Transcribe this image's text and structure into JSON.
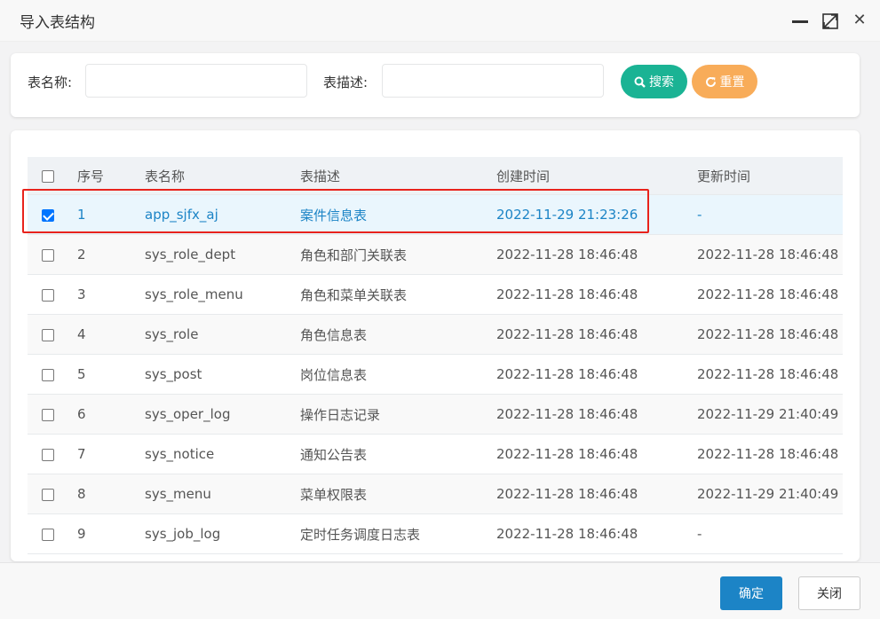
{
  "window": {
    "title": "导入表结构"
  },
  "search": {
    "table_name_label": "表名称:",
    "table_name_value": "",
    "table_desc_label": "表描述:",
    "table_desc_value": "",
    "search_label": "搜索",
    "reset_label": "重置"
  },
  "table": {
    "headers": [
      "序号",
      "表名称",
      "表描述",
      "创建时间",
      "更新时间"
    ],
    "rows": [
      {
        "checked": true,
        "no": "1",
        "name": "app_sjfx_aj",
        "desc": "案件信息表",
        "created": "2022-11-29 21:23:26",
        "updated": "-"
      },
      {
        "checked": false,
        "no": "2",
        "name": "sys_role_dept",
        "desc": "角色和部门关联表",
        "created": "2022-11-28 18:46:48",
        "updated": "2022-11-28 18:46:48"
      },
      {
        "checked": false,
        "no": "3",
        "name": "sys_role_menu",
        "desc": "角色和菜单关联表",
        "created": "2022-11-28 18:46:48",
        "updated": "2022-11-28 18:46:48"
      },
      {
        "checked": false,
        "no": "4",
        "name": "sys_role",
        "desc": "角色信息表",
        "created": "2022-11-28 18:46:48",
        "updated": "2022-11-28 18:46:48"
      },
      {
        "checked": false,
        "no": "5",
        "name": "sys_post",
        "desc": "岗位信息表",
        "created": "2022-11-28 18:46:48",
        "updated": "2022-11-28 18:46:48"
      },
      {
        "checked": false,
        "no": "6",
        "name": "sys_oper_log",
        "desc": "操作日志记录",
        "created": "2022-11-28 18:46:48",
        "updated": "2022-11-29 21:40:49"
      },
      {
        "checked": false,
        "no": "7",
        "name": "sys_notice",
        "desc": "通知公告表",
        "created": "2022-11-28 18:46:48",
        "updated": "2022-11-28 18:46:48"
      },
      {
        "checked": false,
        "no": "8",
        "name": "sys_menu",
        "desc": "菜单权限表",
        "created": "2022-11-28 18:46:48",
        "updated": "2022-11-29 21:40:49"
      },
      {
        "checked": false,
        "no": "9",
        "name": "sys_job_log",
        "desc": "定时任务调度日志表",
        "created": "2022-11-28 18:46:48",
        "updated": "-"
      }
    ]
  },
  "footer": {
    "ok_label": "确定",
    "close_label": "关闭"
  },
  "colors": {
    "search": "#1ab394",
    "reset": "#f8ac59",
    "primary": "#1c84c6",
    "highlight": "#e8231c"
  }
}
